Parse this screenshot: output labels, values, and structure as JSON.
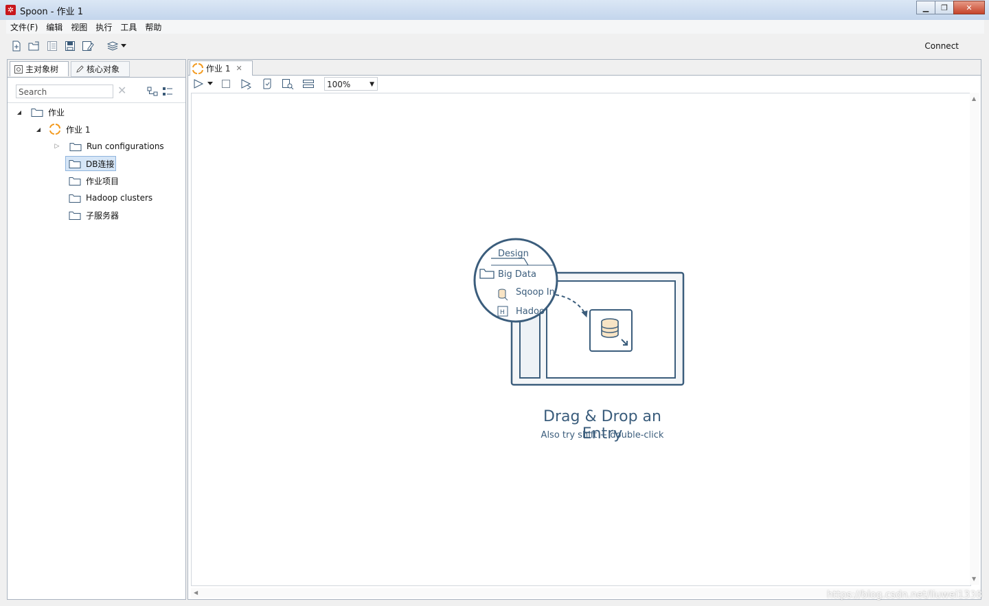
{
  "window": {
    "title": "Spoon - 作业 1"
  },
  "menu": [
    "文件(F)",
    "编辑",
    "视图",
    "执行",
    "工具",
    "帮助"
  ],
  "toolbar": {
    "connect_label": "Connect"
  },
  "left_panel": {
    "tabs": {
      "main": "主对象树",
      "core": "核心对象"
    },
    "search": {
      "placeholder": "Search"
    },
    "tree": {
      "root": "作业",
      "job": "作业 1",
      "run_configurations": "Run configurations",
      "db_connections": "DB连接",
      "job_entries": "作业项目",
      "hadoop_clusters": "Hadoop clusters",
      "slave_servers": "子服务器"
    }
  },
  "editor": {
    "tab_label": "作业 1",
    "zoom": "100%",
    "illustration": {
      "tab": "Design",
      "folder": "Big Data",
      "item1": "Sqoop In",
      "item2": "Hadoo"
    },
    "drag_drop_title": "Drag & Drop an Entry",
    "drag_drop_hint": "Also try shift + double-click"
  },
  "watermark": "https://blog.csdn.net/liuwei1338",
  "colors": {
    "accent": "#3b5d7c",
    "job_icon": "#f39a1e",
    "app_icon": "#c8161d"
  }
}
